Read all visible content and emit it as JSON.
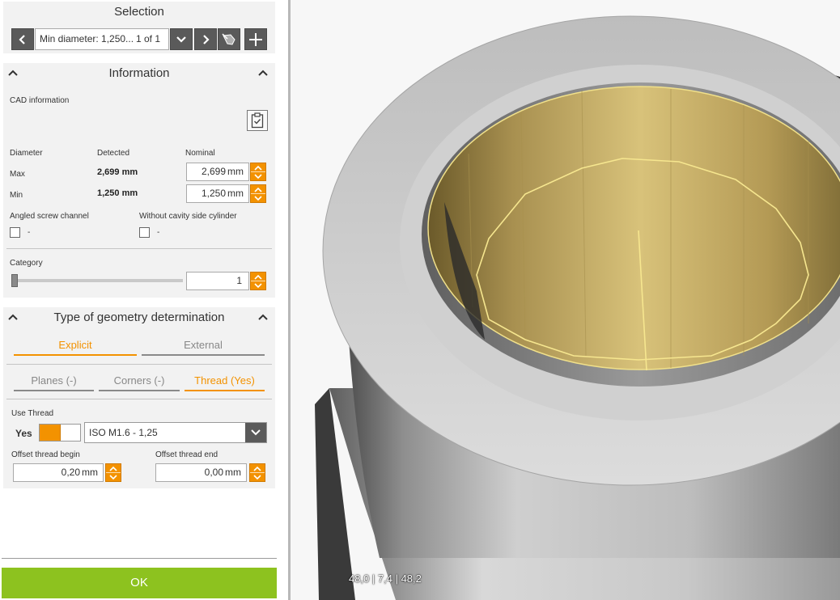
{
  "selection": {
    "title": "Selection",
    "field_text": "Min diameter: 1,250...",
    "count_text": "1 of 1",
    "buttons": [
      "prev",
      "dropdown",
      "next",
      "select-tool",
      "add"
    ]
  },
  "information": {
    "title": "Information",
    "cad_label": "CAD information",
    "diameter": {
      "header": "Diameter",
      "detected_header": "Detected",
      "nominal_header": "Nominal",
      "max_label": "Max",
      "min_label": "Min",
      "max_detected": "2,699 mm",
      "min_detected": "1,250 mm",
      "max_nominal": "2,699",
      "min_nominal": "1,250",
      "unit": "mm"
    },
    "angled_label": "Angled screw channel",
    "angled_value": "-",
    "cavity_label": "Without cavity side cylinder",
    "cavity_value": "-",
    "category_label": "Category",
    "category_value": "1"
  },
  "geometry": {
    "title": "Type of geometry determination",
    "tabs": [
      {
        "label": "Explicit",
        "active": true
      },
      {
        "label": "External",
        "active": false
      }
    ],
    "subtabs": [
      {
        "label": "Planes (-)",
        "active": false
      },
      {
        "label": "Corners (-)",
        "active": false
      },
      {
        "label": "Thread (Yes)",
        "active": true
      }
    ],
    "use_thread_label": "Use Thread",
    "use_thread_value": "Yes",
    "thread_value": "ISO M1.6 - 1,25",
    "offset_begin_label": "Offset thread begin",
    "offset_begin_value": "0,20",
    "offset_end_label": "Offset thread end",
    "offset_end_value": "0,00",
    "unit": "mm"
  },
  "ok_label": "OK",
  "viewport": {
    "coords_text": "48,0  |  7,4 | 48,2"
  },
  "colors": {
    "accent": "#f39200",
    "ok": "#8dc21f",
    "button_dark": "#5a5a5a",
    "highlight_face": "#d8c27a"
  }
}
